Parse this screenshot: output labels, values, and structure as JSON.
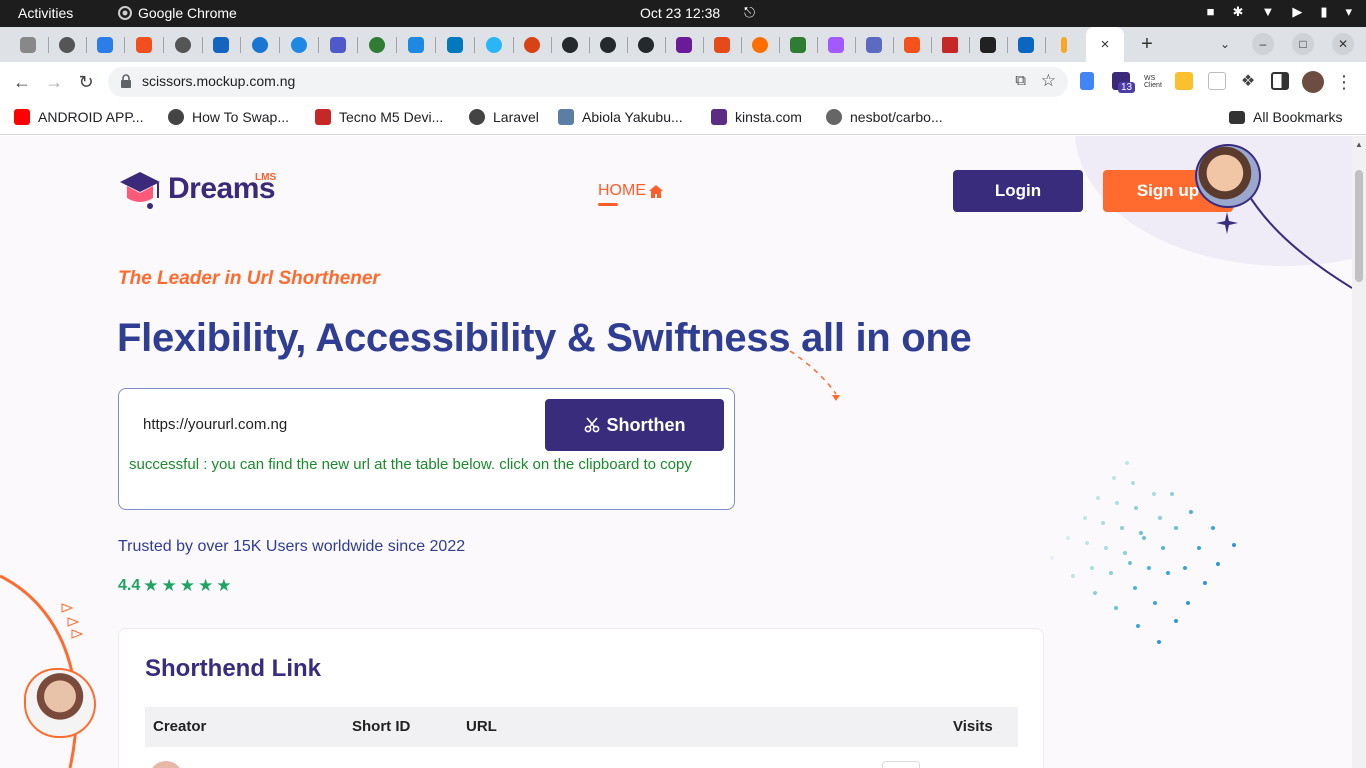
{
  "os": {
    "activities": "Activities",
    "app_name": "Google Chrome",
    "clock": "Oct 23  12:38"
  },
  "browser": {
    "url": "scissors.mockup.com.ng",
    "extension_badge": "13",
    "ws_label": "WS Client",
    "bookmarks": [
      {
        "label": "ANDROID APP...",
        "color": "#ff0000"
      },
      {
        "label": "How To Swap...",
        "color": "#444444"
      },
      {
        "label": "Tecno M5 Devi...",
        "color": "#c62828"
      },
      {
        "label": "Laravel",
        "color": "#444444"
      },
      {
        "label": "Abiola Yakubu...",
        "color": "#5b7ea5"
      },
      {
        "label": "kinsta.com",
        "color": "#5a2d82"
      },
      {
        "label": "nesbot/carbo...",
        "color": "#666666"
      }
    ],
    "all_bookmarks": "All Bookmarks",
    "tab_close": "×",
    "new_tab": "+"
  },
  "page": {
    "brand": {
      "name": "Dreams",
      "badge": "LMS"
    },
    "nav": {
      "home": "HOME"
    },
    "buttons": {
      "login": "Login",
      "signup": "Sign up"
    },
    "tagline": "The Leader in Url Shorthener",
    "headline": "Flexibility, Accessibility & Swiftness all in one",
    "form": {
      "input_value": "https://yoururl.com.ng",
      "shorten": "Shorthen",
      "success": "successful : you can find the new url at the table below. click on the clipboard to copy"
    },
    "trusted": "Trusted by over 15K Users worldwide since 2022",
    "rating": {
      "value": "4.4",
      "stars": 5
    },
    "table": {
      "title": "Shorthend Link",
      "columns": [
        "Creator",
        "Short ID",
        "URL",
        "Visits"
      ]
    }
  },
  "colors": {
    "primary": "#392c7d",
    "accent": "#ff6b2e",
    "headline": "#2f3e93",
    "success": "#1b8a2d",
    "rating": "#1fa463"
  }
}
